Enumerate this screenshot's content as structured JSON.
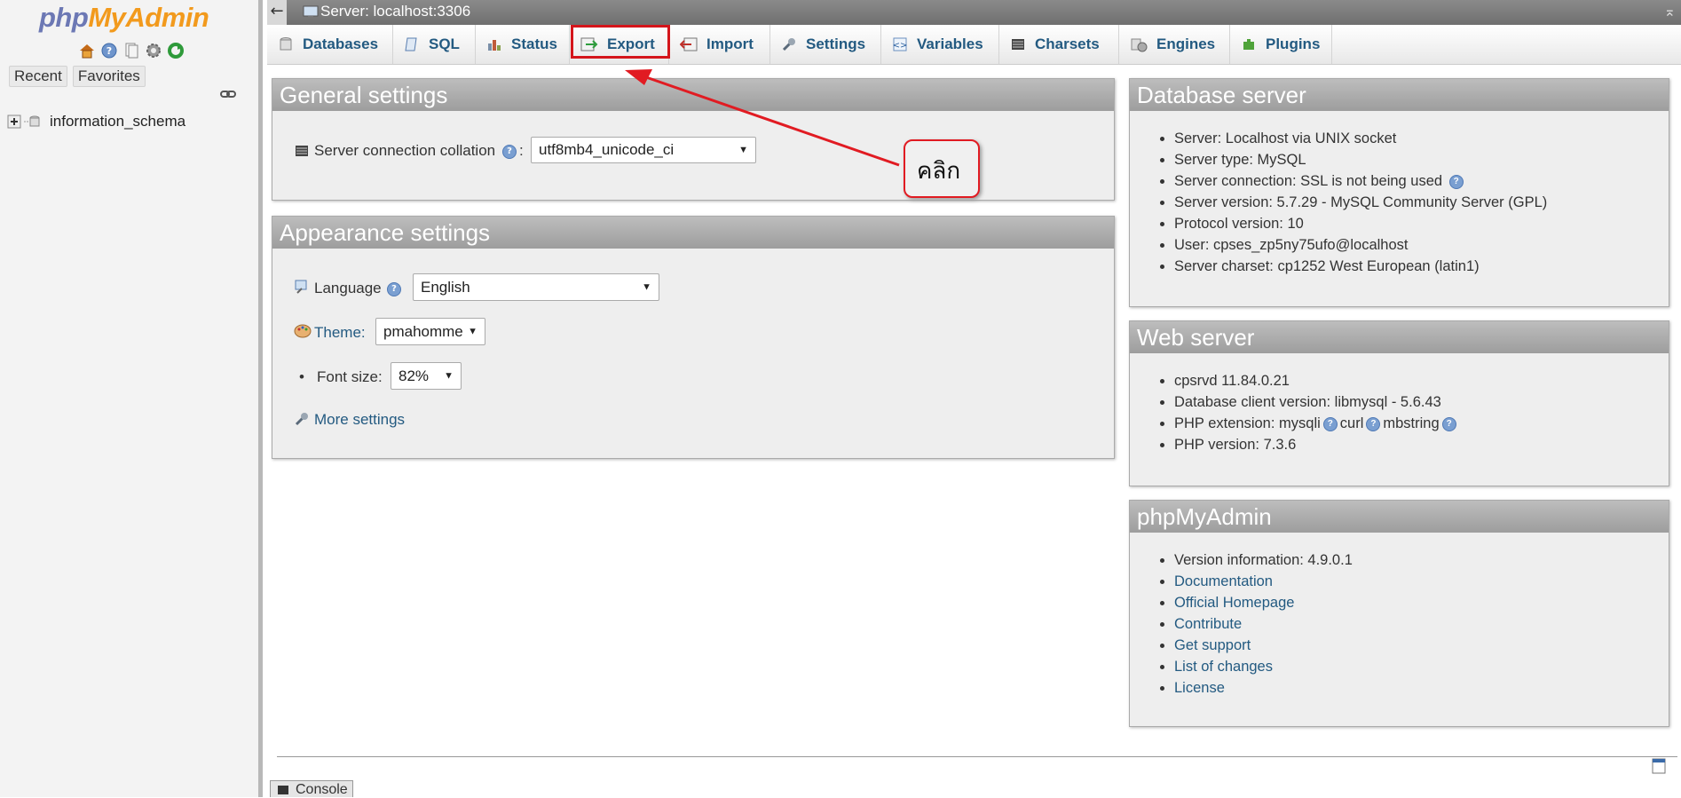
{
  "sidebar": {
    "logo_php": "php",
    "logo_myadmin": "MyAdmin",
    "nav_icons": [
      "home-icon",
      "help-icon",
      "docs-icon",
      "settings-icon",
      "reload-icon"
    ],
    "tabs": [
      "Recent",
      "Favorites"
    ],
    "databases": [
      {
        "name": "information_schema"
      }
    ]
  },
  "topbar": {
    "back": "←",
    "title": "Server: localhost:3306",
    "collapse": "⌅"
  },
  "menu": {
    "tabs": [
      "Databases",
      "SQL",
      "Status",
      "Export",
      "Import",
      "Settings",
      "Variables",
      "Charsets",
      "Engines",
      "Plugins"
    ],
    "highlighted": "Export"
  },
  "general_settings": {
    "title": "General settings",
    "collation_label": "Server connection collation",
    "collation_value": "utf8mb4_unicode_ci"
  },
  "appearance_settings": {
    "title": "Appearance settings",
    "language_label": "Language",
    "language_value": "English",
    "theme_label": "Theme:",
    "theme_value": "pmahomme",
    "font_size_label": "Font size:",
    "font_size_value": "82%",
    "more_settings": "More settings"
  },
  "database_server": {
    "title": "Database server",
    "items": [
      "Server: Localhost via UNIX socket",
      "Server type: MySQL",
      "Server connection: SSL is not being used",
      "Server version: 5.7.29 - MySQL Community Server (GPL)",
      "Protocol version: 10",
      "User: cpses_zp5ny75ufo@localhost",
      "Server charset: cp1252 West European (latin1)"
    ]
  },
  "web_server": {
    "title": "Web server",
    "items": [
      "cpsrvd 11.84.0.21",
      "Database client version: libmysql - 5.6.43"
    ],
    "php_ext_label": "PHP extension:",
    "php_ext": [
      "mysqli",
      "curl",
      "mbstring"
    ],
    "php_version": "PHP version: 7.3.6"
  },
  "phpmyadmin": {
    "title": "phpMyAdmin",
    "version": "Version information: 4.9.0.1",
    "links": [
      "Documentation",
      "Official Homepage",
      "Contribute",
      "Get support",
      "List of changes",
      "License"
    ]
  },
  "annotation": {
    "callout_text": "คลิก",
    "color": "#e11b22"
  },
  "console": {
    "label": "Console"
  },
  "colors": {
    "link": "#235a81",
    "panel_header": "#a8a8a8",
    "highlight": "#d4151b"
  }
}
